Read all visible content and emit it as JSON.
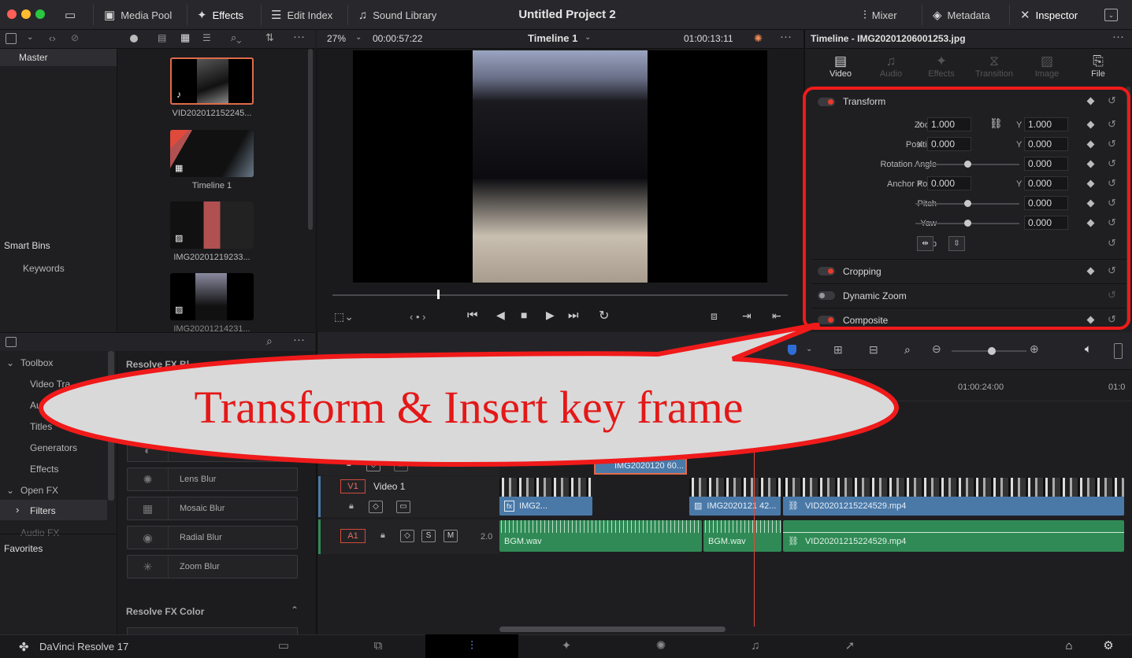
{
  "topbar": {
    "media_pool": "Media Pool",
    "effects": "Effects",
    "edit_index": "Edit Index",
    "sound_library": "Sound Library",
    "project_title": "Untitled Project 2",
    "mixer": "Mixer",
    "metadata": "Metadata",
    "inspector": "Inspector"
  },
  "viewer": {
    "zoom": "27%",
    "timecode_left": "00:00:57:22",
    "timeline_name": "Timeline 1",
    "timecode_right": "01:00:13:11"
  },
  "media_pool": {
    "master": "Master",
    "smart_bins": "Smart Bins",
    "keywords": "Keywords",
    "clips": [
      {
        "name": "VID202012152245..."
      },
      {
        "name": "Timeline 1"
      },
      {
        "name": "IMG20201219233..."
      },
      {
        "name": "IMG20201214231..."
      }
    ]
  },
  "effects_panel": {
    "toolbox": "Toolbox",
    "video_transitions": "Video Tra",
    "audio_transitions": "Au",
    "titles": "Titles",
    "generators": "Generators",
    "effects": "Effects",
    "open_fx": "Open FX",
    "filters": "Filters",
    "audio_fx": "Audio FX",
    "favorites": "Favorites",
    "resolve_fx_header": "Resolve FX Bl",
    "resolve_fx_color": "Resolve FX Color",
    "items": [
      "Lens Blur",
      "Mosaic Blur",
      "Radial Blur",
      "Zoom Blur"
    ]
  },
  "inspector": {
    "header": "Timeline - IMG20201206001253.jpg",
    "tabs": [
      "Video",
      "Audio",
      "Effects",
      "Transition",
      "Image",
      "File"
    ],
    "transform": "Transform",
    "zoom_label": "Zoom",
    "zoom_x": "1.000",
    "zoom_y": "1.000",
    "position_label": "Position",
    "position_x": "0.000",
    "position_y": "0.000",
    "rotation_label": "Rotation Angle",
    "rotation_value": "0.000",
    "anchor_label": "Anchor Point",
    "anchor_x": "0.000",
    "anchor_y": "0.000",
    "pitch_label": "Pitch",
    "pitch_value": "0.000",
    "yaw_label": "Yaw",
    "yaw_value": "0.000",
    "flip_label": "Flip",
    "x_axis": "X",
    "y_axis": "Y",
    "cropping": "Cropping",
    "dynamic_zoom": "Dynamic Zoom",
    "composite": "Composite"
  },
  "timeline": {
    "ruler_tc": "01:00:24:00",
    "ruler_tc2": "01:0",
    "track_v1": "V1",
    "track_v1_name": "Video 1",
    "track_a1": "A1",
    "audio_level": "2.0",
    "solo": "S",
    "mute": "M",
    "clip_top": "IMG2020120 60...",
    "clip_v1_a": "IMG2...",
    "clip_v1_b": "IMG2020121 42...",
    "clip_v1_c": "VID20201215224529.mp4",
    "clip_a1_a": "BGM.wav",
    "clip_a1_b": "BGM.wav",
    "clip_a1_c": "VID20201215224529.mp4"
  },
  "callout": {
    "text": "Transform & Insert key frame"
  },
  "footer": {
    "app_name": "DaVinci Resolve 17"
  }
}
